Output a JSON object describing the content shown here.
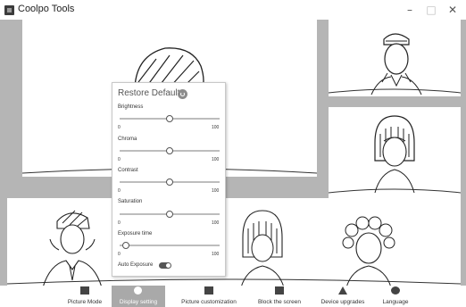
{
  "window": {
    "title": "Coolpo Tools",
    "minimize": "–",
    "maximize": "□",
    "close": "✕"
  },
  "settings": {
    "restore_label": "Restore Default",
    "sliders": [
      {
        "label": "Brightness",
        "min": "0",
        "max": "100",
        "value_fraction": 0.5
      },
      {
        "label": "Chroma",
        "min": "0",
        "max": "100",
        "value_fraction": 0.5
      },
      {
        "label": "Contrast",
        "min": "0",
        "max": "100",
        "value_fraction": 0.5
      },
      {
        "label": "Saturation",
        "min": "0",
        "max": "100",
        "value_fraction": 0.5
      },
      {
        "label": "Exposure time",
        "min": "0",
        "max": "100",
        "value_fraction": 0.03
      }
    ],
    "auto_exposure_label": "Auto Exposure",
    "auto_exposure_on": true
  },
  "nav": {
    "items": [
      {
        "label": "Picture Mode",
        "icon": "layout-icon",
        "active": false
      },
      {
        "label": "Display setting",
        "icon": "settings-icon",
        "active": true
      },
      {
        "label": "Picture customization",
        "icon": "image-icon",
        "active": false
      },
      {
        "label": "Block the screen",
        "icon": "block-icon",
        "active": false
      },
      {
        "label": "Device upgrades",
        "icon": "upload-icon",
        "active": false
      },
      {
        "label": "Language",
        "icon": "globe-icon",
        "active": false
      }
    ]
  },
  "colors": {
    "background": "#b5b5b5",
    "panel": "#ffffff",
    "active_nav": "#a9a9a9"
  }
}
